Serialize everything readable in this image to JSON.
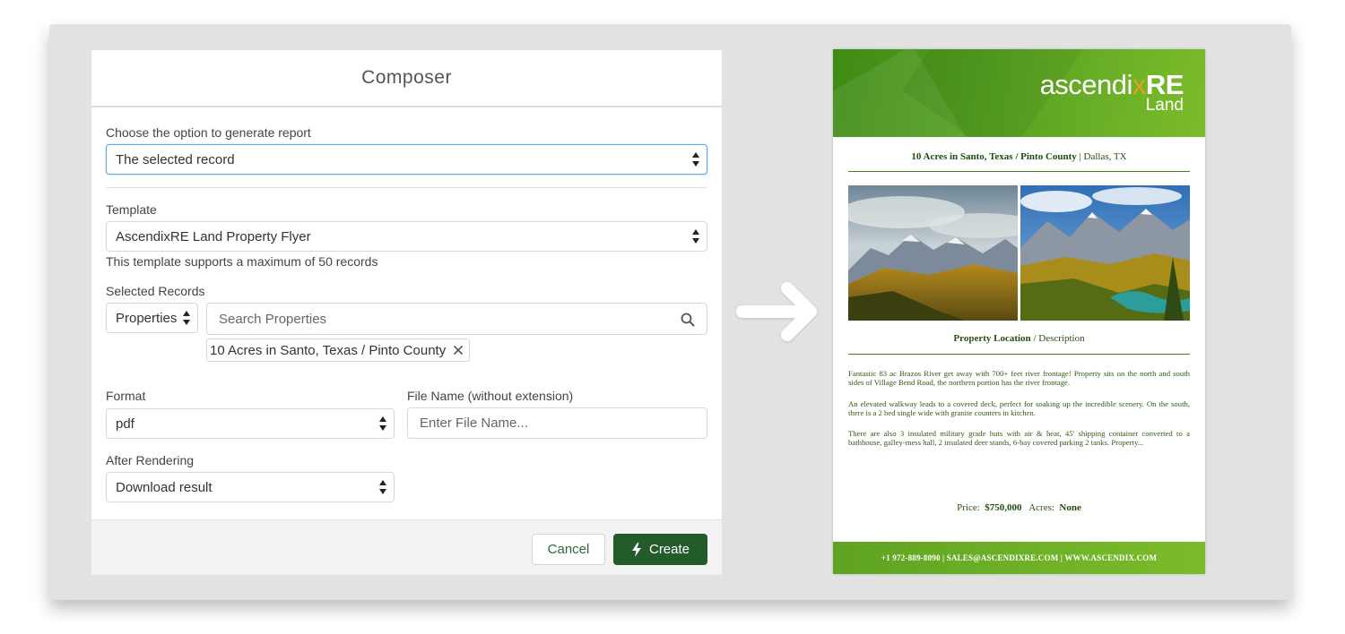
{
  "composer": {
    "title": "Composer",
    "report_option": {
      "label": "Choose the option to generate report",
      "value": "The selected record"
    },
    "template": {
      "label": "Template",
      "value": "AscendixRE Land Property Flyer",
      "helper": "This template supports a maximum of 50 records"
    },
    "selected_records": {
      "label": "Selected Records",
      "object_value": "Properties",
      "search_placeholder": "Search Properties",
      "chip": "10 Acres in Santo, Texas / Pinto County"
    },
    "format": {
      "label": "Format",
      "value": "pdf"
    },
    "file_name": {
      "label": "File Name (without extension)",
      "placeholder": "Enter File Name..."
    },
    "after_rendering": {
      "label": "After Rendering",
      "value": "Download result"
    },
    "buttons": {
      "cancel": "Cancel",
      "create": "Create"
    }
  },
  "flyer": {
    "logo": {
      "prefix": "ascendi",
      "x": "x",
      "suffix": "RE",
      "sub": "Land"
    },
    "title_bold": "10 Acres in Santo, Texas / Pinto County",
    "title_rest": " | Dallas, TX",
    "section_bold": "Property Location",
    "section_rest": " / Description",
    "paragraphs": [
      "Fantastic 83 ac Brazos River get away with 700+ feet river frontage! Property sits on the north and south sides of Village Bend Road, the northern portion has the river frontage.",
      "An elevated walkway leads to a covered deck, perfect for soaking up the incredible scenery. On the south, there is a 2 bed single wide with granite counters in kitchen.",
      "There are also 3 insulated military grade huts with air & heat, 45' shipping container converted to a bathhouse, galley-mess hall, 2 insulated deer stands, 6-bay covered parking 2 tanks. Property..."
    ],
    "price_label": "Price:",
    "price_value": "$750,000",
    "acres_label": "Acres:",
    "acres_value": "None",
    "footer": "+1 972-889-8090 | SALES@ASCENDIXRE.COM | WWW.ASCENDIX.COM"
  },
  "colors": {
    "create_button": "#235b2b",
    "focus_border": "#5ea6e6",
    "flyer_green": "#6bb026",
    "logo_accent": "#e6a11a"
  }
}
